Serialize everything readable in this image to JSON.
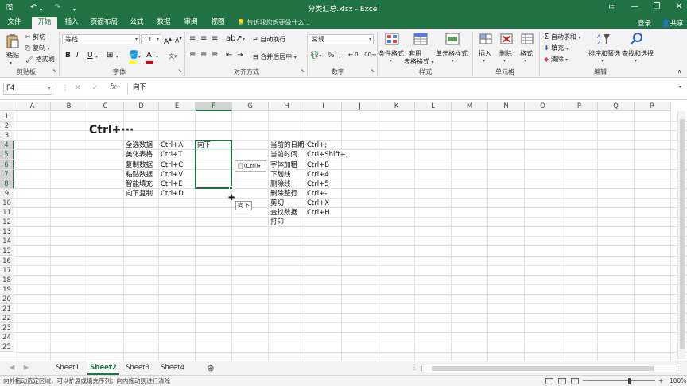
{
  "window": {
    "title": "分类汇总.xlsx - Excel",
    "login": "登录",
    "share": "共享",
    "tell_me": "告诉我您想要做什么..."
  },
  "tabs": [
    "文件",
    "开始",
    "插入",
    "页面布局",
    "公式",
    "数据",
    "审阅",
    "视图"
  ],
  "active_tab": "开始",
  "ribbon": {
    "clipboard": {
      "label": "剪贴板",
      "paste": "粘贴",
      "cut": "剪切",
      "copy": "复制",
      "format_painter": "格式刷"
    },
    "font": {
      "label": "字体",
      "name": "等线",
      "size": "11",
      "bold": "B",
      "italic": "I",
      "underline": "U"
    },
    "alignment": {
      "label": "对齐方式",
      "wrap": "自动换行",
      "merge": "合并后居中"
    },
    "number": {
      "label": "数字",
      "format": "常规",
      "percent": "%",
      "comma": ","
    },
    "styles": {
      "label": "样式",
      "conditional": "条件格式",
      "table": "套用\n表格格式",
      "cell_styles": "单元格样式"
    },
    "cells": {
      "label": "单元格",
      "insert": "插入",
      "delete": "删除",
      "format": "格式"
    },
    "editing": {
      "label": "编辑",
      "autosum": "自动求和",
      "fill": "填充",
      "clear": "清除",
      "sort": "排序和筛选",
      "find": "查找和选择"
    }
  },
  "formula_bar": {
    "name_box": "F4",
    "content": "向下"
  },
  "columns": [
    "A",
    "B",
    "C",
    "D",
    "E",
    "F",
    "G",
    "H",
    "I",
    "J",
    "K",
    "L",
    "M",
    "N",
    "O",
    "P",
    "Q",
    "R"
  ],
  "rows": [
    "1",
    "2",
    "3",
    "4",
    "5",
    "6",
    "7",
    "8",
    "9",
    "10",
    "11",
    "12",
    "13",
    "14",
    "15",
    "16",
    "17",
    "18",
    "19",
    "20",
    "21",
    "22",
    "23",
    "24",
    "25"
  ],
  "big_title": "Ctrl+···",
  "table_left": [
    {
      "name": "全选数据",
      "key": "Ctrl+A"
    },
    {
      "name": "美化表格",
      "key": "Ctrl+T"
    },
    {
      "name": "复制数据",
      "key": "Ctrl+C"
    },
    {
      "name": "粘贴数据",
      "key": "Ctrl+V"
    },
    {
      "name": "智能填充",
      "key": "Ctrl+E"
    },
    {
      "name": "向下复制",
      "key": "Ctrl+D"
    }
  ],
  "table_right": [
    {
      "name": "当前的日期",
      "key": "Ctrl+;"
    },
    {
      "name": "当前时间",
      "key": "Ctrl+Shift+;"
    },
    {
      "name": "字体加粗",
      "key": "Ctrl+B"
    },
    {
      "name": "下划线",
      "key": "Ctrl+4"
    },
    {
      "name": "删除线",
      "key": "Ctrl+5"
    },
    {
      "name": "删除整行",
      "key": "Ctrl+-"
    },
    {
      "name": "剪切",
      "key": "Ctrl+X"
    },
    {
      "name": "查找数据",
      "key": "Ctrl+H"
    },
    {
      "name": "打印",
      "key": ""
    }
  ],
  "active_cell_value": "向下",
  "paste_options": "(Ctrl)",
  "fill_tooltip": "向下",
  "sheets": [
    "Sheet1",
    "Sheet2",
    "Sheet3",
    "Sheet4"
  ],
  "active_sheet": "Sheet2",
  "status": {
    "message": "向外拖动选定区域，可以扩展或填充序列；向内拖动则进行清除",
    "zoom": "100%"
  },
  "colors": {
    "accent": "#217346",
    "ribbon_bg": "#f3f3f3",
    "grid_line": "#e2e2e2"
  }
}
